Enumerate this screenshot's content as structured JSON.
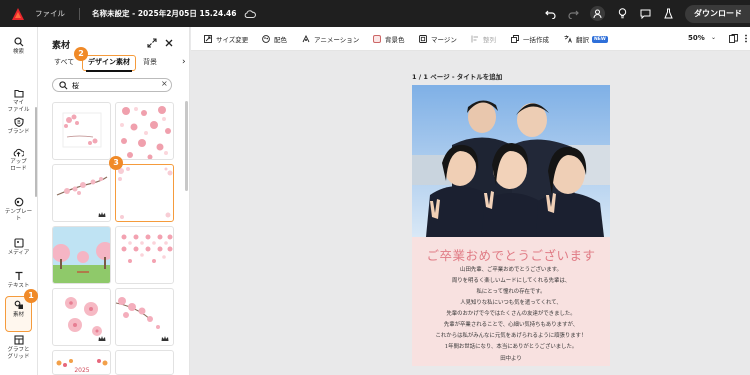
{
  "app": {
    "menu_file": "ファイル",
    "doc_title": "名称未設定 - 2025年2月05日 15.24.46",
    "download": "ダウンロード"
  },
  "rail": {
    "items": [
      {
        "label": "検索",
        "icon": "search-icon"
      },
      {
        "label": "マイ\nファイル",
        "icon": "folder-icon"
      },
      {
        "label": "ブランド",
        "icon": "brand-icon"
      },
      {
        "label": "アップ\nロード",
        "icon": "upload-icon"
      },
      {
        "label": "テンプレー\nト",
        "icon": "template-icon"
      },
      {
        "label": "メディア",
        "icon": "media-icon"
      },
      {
        "label": "テキスト",
        "icon": "text-icon"
      },
      {
        "label": "素材",
        "icon": "elements-icon"
      },
      {
        "label": "グラフと\nグリッド",
        "icon": "chart-grid-icon"
      }
    ],
    "badge_1": "1"
  },
  "panel": {
    "title": "素材",
    "tabs": [
      "すべて",
      "デザイン素材",
      "背景"
    ],
    "badge_2": "2",
    "badge_3": "3",
    "search_value": "桜"
  },
  "toolbar": {
    "items": [
      "サイズ変更",
      "配色",
      "アニメーション",
      "背景色",
      "マージン",
      "整列",
      "一括作成",
      "翻訳"
    ],
    "new_badge": "NEW",
    "zoom": "50%"
  },
  "canvas": {
    "page_label": "1 / 1 ページ - タイトルを追加",
    "greeting": "ご卒業おめでとうございます",
    "message": [
      "山田先輩、ご卒業おめでとうございます。",
      "周りを明るく楽しいムードにしてくれる先輩は、",
      "私にとって憧れの存在です。",
      "人見知りな私にいつも気を遣ってくれて、",
      "先輩のおかげで今ではたくさんの友達ができました。",
      "先輩が卒業されることで、心細い気持ちもありますが、",
      "これからは私がみんなに元気をあげられるように頑張ります！",
      "1年間お世話になり、本当にありがとうございました。",
      "田中より"
    ]
  },
  "colors": {
    "accent": "#f59b3c",
    "badge": "#f08a28",
    "greeting": "#e07b85",
    "card_bg": "#f8e1e0"
  }
}
